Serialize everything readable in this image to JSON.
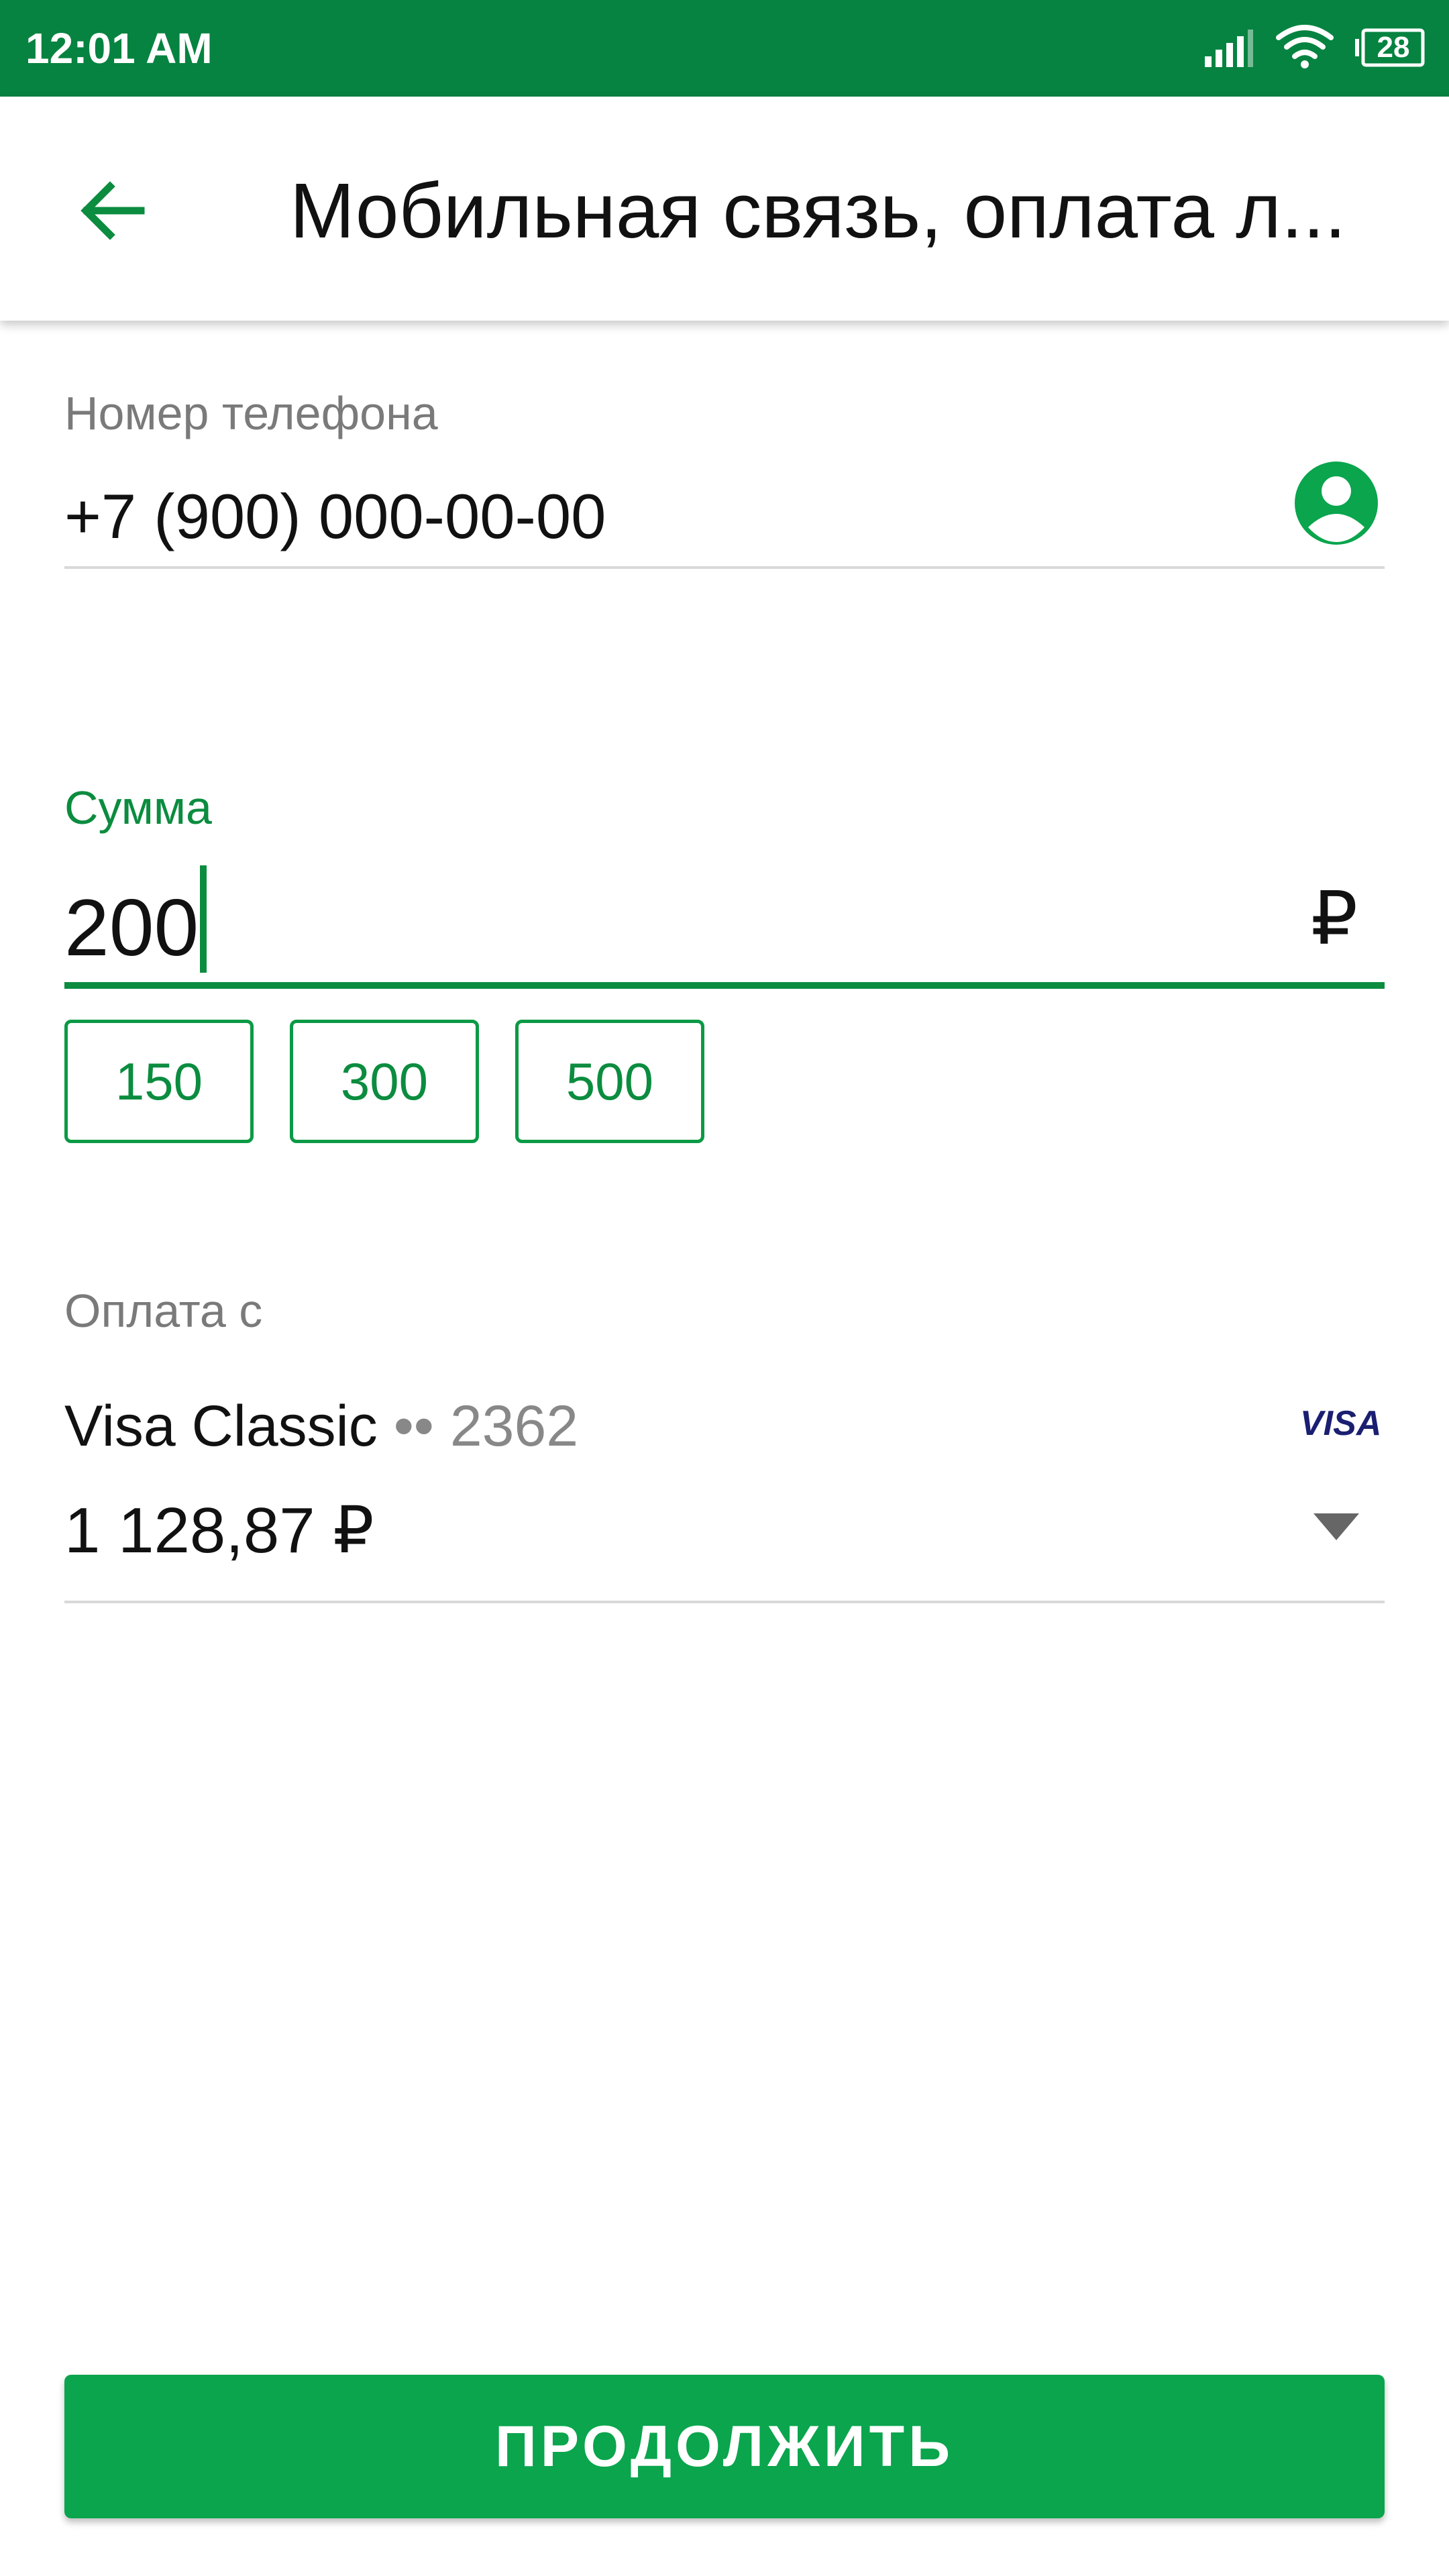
{
  "status_bar": {
    "time": "12:01 AM",
    "battery": "28",
    "icons": [
      "signal-icon",
      "wifi-icon",
      "battery-icon"
    ]
  },
  "header": {
    "title": "Мобильная связь, оплата л...",
    "back_icon": "arrow-left-icon"
  },
  "phone": {
    "label": "Номер телефона",
    "value": "+7 (900) 000-00-00",
    "contact_icon": "contact-icon"
  },
  "amount": {
    "label": "Сумма",
    "value": "200",
    "currency": "₽",
    "quick_amounts": [
      "150",
      "300",
      "500"
    ]
  },
  "payment": {
    "label": "Оплата с",
    "card_name": "Visa Classic",
    "card_mask": "•• 2362",
    "brand": "VISA",
    "balance": "1 128,87 ₽"
  },
  "continue_label": "ПРОДОЛЖИТЬ",
  "colors": {
    "status_bar": "#068340",
    "accent": "#0b8c3f",
    "button": "#0aa54d",
    "visa": "#1a1f71"
  }
}
